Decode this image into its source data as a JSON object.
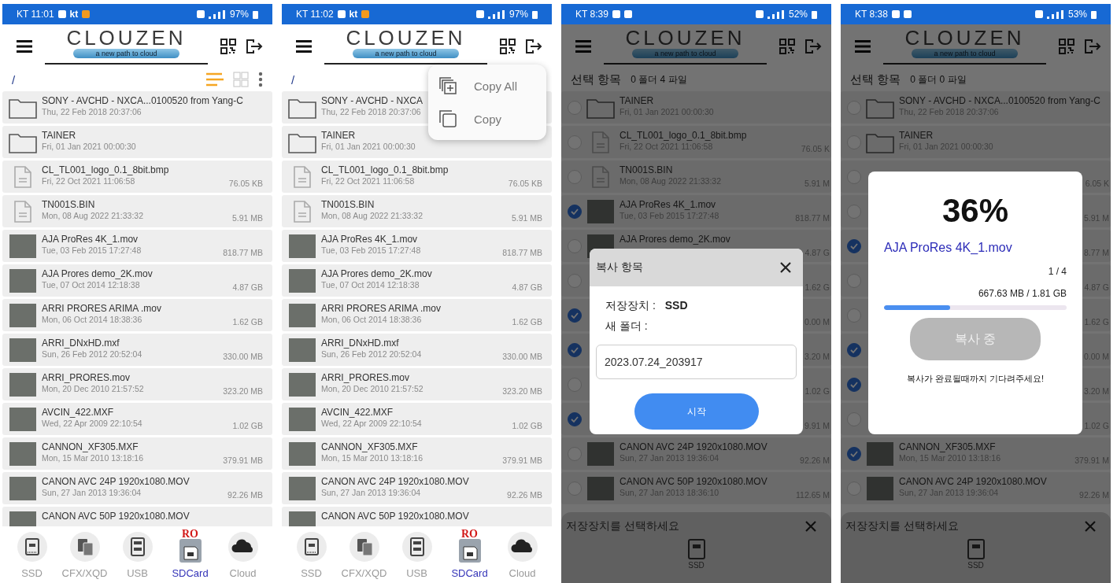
{
  "phones": [
    {
      "kind": "browser",
      "status_bar": {
        "time": "KT 11:01",
        "badge": "kt",
        "battery": "97%"
      },
      "header": {
        "logo": "CLOUZEN",
        "tagline": "a new path to cloud"
      },
      "toolbar": {
        "path": "/"
      },
      "rows": [
        {
          "kind": "folder",
          "name": "SONY - AVCHD - NXCA...0100520 from Yang-C",
          "date": "Thu, 22 Feb 2018 20:37:06"
        },
        {
          "kind": "folder",
          "name": "TAINER",
          "date": "Fri, 01 Jan 2021 00:00:30"
        },
        {
          "kind": "file",
          "name": "CL_TL001_logo_0.1_8bit.bmp",
          "date": "Fri, 22 Oct 2021 11:06:58",
          "size": "76.05 KB"
        },
        {
          "kind": "file",
          "name": "TN001S.BIN",
          "date": "Mon, 08 Aug 2022 21:33:32",
          "size": "5.91 MB"
        },
        {
          "kind": "video",
          "name": "AJA ProRes 4K_1.mov",
          "date": "Tue, 03 Feb 2015 17:27:48",
          "size": "818.77 MB"
        },
        {
          "kind": "video",
          "name": "AJA Prores demo_2K.mov",
          "date": "Tue, 07 Oct 2014 12:18:38",
          "size": "4.87 GB"
        },
        {
          "kind": "video",
          "name": "ARRI PRORES ARIMA .mov",
          "date": "Mon, 06 Oct 2014 18:38:36",
          "size": "1.62 GB"
        },
        {
          "kind": "video",
          "name": "ARRI_DNxHD.mxf",
          "date": "Sun, 26 Feb 2012 20:52:04",
          "size": "330.00 MB"
        },
        {
          "kind": "video",
          "name": "ARRI_PRORES.mov",
          "date": "Mon, 20 Dec 2010 21:57:52",
          "size": "323.20 MB"
        },
        {
          "kind": "video",
          "name": "AVCIN_422.MXF",
          "date": "Wed, 22 Apr 2009 22:10:54",
          "size": "1.02 GB"
        },
        {
          "kind": "video",
          "name": "CANNON_XF305.MXF",
          "date": "Mon, 15 Mar 2010 13:18:16",
          "size": "379.91 MB"
        },
        {
          "kind": "video",
          "name": "CANON AVC 24P 1920x1080.MOV",
          "date": "Sun, 27 Jan 2013 19:36:04",
          "size": "92.26 MB"
        },
        {
          "kind": "video",
          "name": "CANON AVC 50P 1920x1080.MOV"
        }
      ],
      "nav": [
        {
          "kind": "ssd",
          "label": "SSD",
          "selected": false
        },
        {
          "kind": "cards",
          "label": "CFX/XQD",
          "selected": false
        },
        {
          "kind": "usb",
          "label": "USB",
          "selected": false
        },
        {
          "kind": "sd",
          "label": "SDCard",
          "selected": true,
          "badge": "RO"
        },
        {
          "kind": "cloud",
          "label": "Cloud",
          "selected": false
        }
      ]
    },
    {
      "kind": "browser",
      "status_bar": {
        "time": "KT 11:02",
        "badge": "kt",
        "battery": "97%"
      },
      "header": {
        "logo": "CLOUZEN",
        "tagline": "a new path to cloud"
      },
      "toolbar": {
        "path": "/"
      },
      "menu": [
        {
          "kind": "copy-all",
          "label": "Copy All"
        },
        {
          "kind": "copy",
          "label": "Copy"
        }
      ],
      "rows": [
        {
          "kind": "folder",
          "name": "SONY - AVCHD - NXCA",
          "date": "Thu, 22 Feb 2018 20:37:06"
        },
        {
          "kind": "folder",
          "name": "TAINER",
          "date": "Fri, 01 Jan 2021 00:00:30"
        },
        {
          "kind": "file",
          "name": "CL_TL001_logo_0.1_8bit.bmp",
          "date": "Fri, 22 Oct 2021 11:06:58",
          "size": "76.05 KB"
        },
        {
          "kind": "file",
          "name": "TN001S.BIN",
          "date": "Mon, 08 Aug 2022 21:33:32",
          "size": "5.91 MB"
        },
        {
          "kind": "video",
          "name": "AJA ProRes 4K_1.mov",
          "date": "Tue, 03 Feb 2015 17:27:48",
          "size": "818.77 MB"
        },
        {
          "kind": "video",
          "name": "AJA Prores demo_2K.mov",
          "date": "Tue, 07 Oct 2014 12:18:38",
          "size": "4.87 GB"
        },
        {
          "kind": "video",
          "name": "ARRI PRORES ARIMA .mov",
          "date": "Mon, 06 Oct 2014 18:38:36",
          "size": "1.62 GB"
        },
        {
          "kind": "video",
          "name": "ARRI_DNxHD.mxf",
          "date": "Sun, 26 Feb 2012 20:52:04",
          "size": "330.00 MB"
        },
        {
          "kind": "video",
          "name": "ARRI_PRORES.mov",
          "date": "Mon, 20 Dec 2010 21:57:52",
          "size": "323.20 MB"
        },
        {
          "kind": "video",
          "name": "AVCIN_422.MXF",
          "date": "Wed, 22 Apr 2009 22:10:54",
          "size": "1.02 GB"
        },
        {
          "kind": "video",
          "name": "CANNON_XF305.MXF",
          "date": "Mon, 15 Mar 2010 13:18:16",
          "size": "379.91 MB"
        },
        {
          "kind": "video",
          "name": "CANON AVC 24P 1920x1080.MOV",
          "date": "Sun, 27 Jan 2013 19:36:04",
          "size": "92.26 MB"
        },
        {
          "kind": "video",
          "name": "CANON AVC 50P 1920x1080.MOV"
        }
      ],
      "nav": [
        {
          "kind": "ssd",
          "label": "SSD",
          "selected": false
        },
        {
          "kind": "cards",
          "label": "CFX/XQD",
          "selected": false
        },
        {
          "kind": "usb",
          "label": "USB",
          "selected": false
        },
        {
          "kind": "sd",
          "label": "SDCard",
          "selected": true,
          "badge": "RO"
        },
        {
          "kind": "cloud",
          "label": "Cloud",
          "selected": false
        }
      ]
    },
    {
      "kind": "select",
      "status_bar": {
        "time": "KT 8:39",
        "battery": "52%"
      },
      "header": {
        "logo": "CLOUZEN",
        "tagline": "a new path to cloud"
      },
      "selection": {
        "label": "선택 항목",
        "counts": "0 폴더 4 파일"
      },
      "rows": [
        {
          "kind": "folder",
          "name": "TAINER",
          "date": "Fri, 01 Jan 2021 00:00:30",
          "selected": false
        },
        {
          "kind": "file",
          "name": "CL_TL001_logo_0.1_8bit.bmp",
          "date": "Fri, 22 Oct 2021 11:06:58",
          "size": "76.05 K",
          "selected": false
        },
        {
          "kind": "file",
          "name": "TN001S.BIN",
          "date": "Mon, 08 Aug 2022 21:33:32",
          "size": "5.91 M",
          "selected": false
        },
        {
          "kind": "video",
          "name": "AJA ProRes 4K_1.mov",
          "date": "Tue, 03 Feb 2015 17:27:48",
          "size": "818.77 M",
          "selected": true
        },
        {
          "kind": "video",
          "name": "AJA Prores demo_2K.mov",
          "size": "4.87 G",
          "selected": false
        },
        {
          "size": "1.62 G",
          "selected": false
        },
        {
          "size": "0.00 M",
          "selected": true
        },
        {
          "size": "3.20 M",
          "selected": true
        },
        {
          "size": "1.02 G",
          "selected": false
        },
        {
          "size": "9.91 M",
          "selected": true
        },
        {
          "kind": "video",
          "name": "CANON AVC 24P 1920x1080.MOV",
          "date": "Sun, 27 Jan 2013 19:36:04",
          "size": "92.26 M",
          "selected": false
        },
        {
          "kind": "video",
          "name": "CANON AVC 50P 1920x1080.MOV",
          "date": "Sun, 27 Jan 2013 18:36:10",
          "size": "112.65 M",
          "selected": false
        }
      ],
      "sheet": {
        "title": "저장장치를 선택하세요",
        "device": "SSD"
      },
      "dialog": {
        "kind": "setup",
        "title": "복사 항목",
        "storage_label": "저장장치 :",
        "storage": "SSD",
        "folder_label": "새 폴더 :",
        "folder": "2023.07.24_203917",
        "button": "시작",
        "button_disabled": false
      }
    },
    {
      "kind": "select",
      "status_bar": {
        "time": "KT 8:38",
        "battery": "53%"
      },
      "header": {
        "logo": "CLOUZEN",
        "tagline": "a new path to cloud"
      },
      "selection": {
        "label": "선택 항목",
        "counts": "0 폴더 0 파일"
      },
      "rows": [
        {
          "kind": "folder",
          "name": "SONY - AVCHD - NXCA...0100520 from Yang-C",
          "date": "Thu, 22 Feb 2018 20:37:06",
          "selected": false
        },
        {
          "kind": "folder",
          "name": "TAINER",
          "date": "Fri, 01 Jan 2021 00:00:30",
          "selected": false
        },
        {
          "size": "6.05 K",
          "selected": false
        },
        {
          "size": "5.91 M",
          "selected": false
        },
        {
          "size": "8.77 M",
          "selected": true
        },
        {
          "size": "4.87 G",
          "selected": false
        },
        {
          "size": "1.62 G",
          "selected": false
        },
        {
          "size": "0.00 M",
          "selected": true
        },
        {
          "size": "3.20 M",
          "selected": true
        },
        {
          "size": "1.02 G",
          "selected": false
        },
        {
          "kind": "video",
          "name": "CANNON_XF305.MXF",
          "date": "Mon, 15 Mar 2010 13:18:16",
          "size": "379.91 M",
          "selected": true
        },
        {
          "kind": "video",
          "name": "CANON AVC 24P 1920x1080.MOV",
          "date": "Sun, 27 Jan 2013 19:36:04",
          "size": "92.26 M",
          "selected": false
        }
      ],
      "sheet": {
        "title": "저장장치를 선택하세요",
        "device": "SSD"
      },
      "dialog": {
        "kind": "progress",
        "percent": "36%",
        "file": "AJA ProRes 4K_1.mov",
        "count": "1 / 4",
        "bytes": "667.63 MB / 1.81 GB",
        "level": 0.36,
        "button": "복사 중",
        "button_disabled": true,
        "note": "복사가 완료될때까지 기다려주세요!"
      }
    }
  ]
}
